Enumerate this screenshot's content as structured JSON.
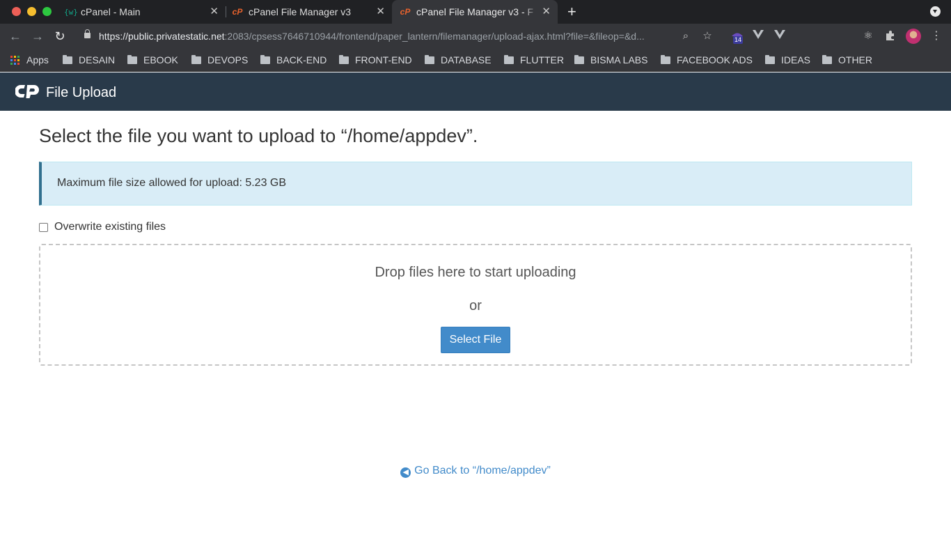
{
  "browser": {
    "tabs": [
      {
        "favicon": "{w}",
        "title": "cPanel - Main"
      },
      {
        "favicon": "cP",
        "title": "cPanel File Manager v3"
      },
      {
        "favicon": "cP",
        "title": "cPanel File Manager v3 - F"
      }
    ],
    "url_host": "https://public.privatestatic.net",
    "url_path": ":2083/cpsess7646710944/frontend/paper_lantern/filemanager/upload-ajax.html?file=&fileop=&d...",
    "extension_badge": "14",
    "bookmarks": [
      "Apps",
      "DESAIN",
      "EBOOK",
      "DEVOPS",
      "BACK-END",
      "FRONT-END",
      "DATABASE",
      "FLUTTER",
      "BISMA LABS",
      "FACEBOOK ADS",
      "IDEAS",
      "OTHER"
    ],
    "colors": {
      "tab_bg": "#202124",
      "toolbar_bg": "#35363a"
    },
    "icons": [
      "back-arrow-icon",
      "forward-arrow-icon",
      "reload-icon",
      "lock-icon",
      "zoom-icon",
      "star-icon",
      "extensions-icon",
      "menu-icon"
    ]
  },
  "cpanel": {
    "header_title": "File Upload",
    "header_color": "#293a4a",
    "page_heading": "Select the file you want to upload to “/home/appdev”.",
    "alert_text": "Maximum file size allowed for upload: 5.23 GB",
    "overwrite_label": "Overwrite existing files",
    "overwrite_checked": false,
    "drop_text": "Drop files here to start uploading",
    "or_text": "or",
    "select_button": "Select File",
    "go_back_text": "Go Back to “/home/appdev”",
    "accent_color": "#428bca"
  }
}
